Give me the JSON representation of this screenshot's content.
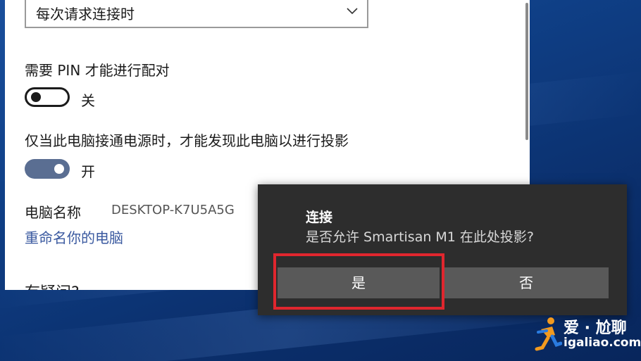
{
  "settings": {
    "dropdown_value": "每次请求连接时",
    "pin_label": "需要 PIN 才能进行配对",
    "pin_state": "关",
    "power_label": "仅当此电脑接通电源时，才能发现此电脑以进行投影",
    "power_state": "开",
    "pc_name_label": "电脑名称",
    "pc_name_value": "DESKTOP-K7U5A5G",
    "rename_link": "重命名你的电脑",
    "cut_heading": "有疑问?"
  },
  "dialog": {
    "title": "连接",
    "message": "是否允许 Smartisan M1 在此处投影?",
    "yes_label": "是",
    "no_label": "否"
  },
  "watermark": {
    "line1": "爱 · 尬聊",
    "line2": "igaliao.com"
  },
  "colors": {
    "highlight": "#e0262e",
    "toggle_on": "#5a6e92",
    "link": "#3b5aa0",
    "dialog_bg": "#2d2d2d",
    "button_bg": "#595959"
  }
}
